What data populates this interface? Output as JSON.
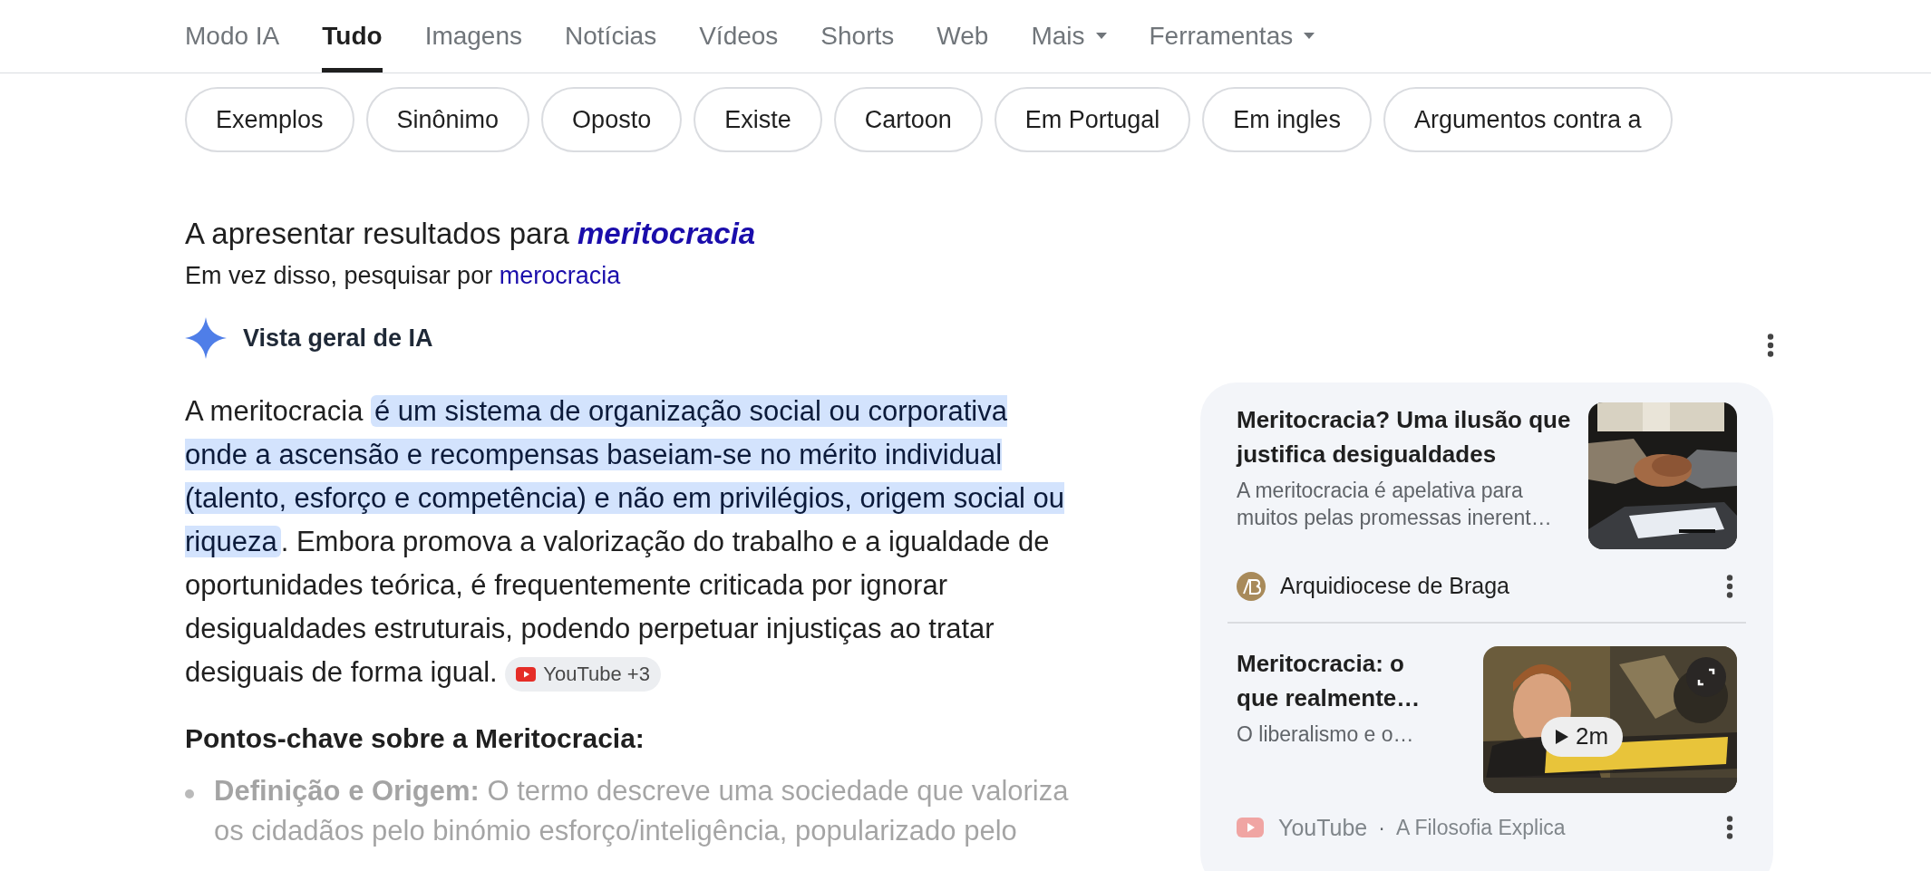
{
  "tabs": [
    {
      "label": "Modo IA",
      "selected": false,
      "dropdown": false
    },
    {
      "label": "Tudo",
      "selected": true,
      "dropdown": false
    },
    {
      "label": "Imagens",
      "selected": false,
      "dropdown": false
    },
    {
      "label": "Notícias",
      "selected": false,
      "dropdown": false
    },
    {
      "label": "Vídeos",
      "selected": false,
      "dropdown": false
    },
    {
      "label": "Shorts",
      "selected": false,
      "dropdown": false
    },
    {
      "label": "Web",
      "selected": false,
      "dropdown": false
    },
    {
      "label": "Mais",
      "selected": false,
      "dropdown": true
    },
    {
      "label": "Ferramentas",
      "selected": false,
      "dropdown": true
    }
  ],
  "chips": [
    "Exemplos",
    "Sinônimo",
    "Oposto",
    "Existe",
    "Cartoon",
    "Em Portugal",
    "Em ingles",
    "Argumentos contra a"
  ],
  "spelling": {
    "showing_prefix": "A apresentar resultados para",
    "corrected": "meritocracia",
    "instead_prefix": "Em vez disso, pesquisar por",
    "original": "merocracia"
  },
  "ai_overview": {
    "title": "Vista geral de IA",
    "paragraph": [
      {
        "text": "A meritocracia ",
        "highlighted": false
      },
      {
        "text": "é um sistema de organização social ou corporativa onde a ascensão e recompensas baseiam-se no mérito individual (talento, esforço e competência) e não em privilégios, origem social ou riqueza",
        "highlighted": true
      },
      {
        "text": ". Embora promova a valorização do trabalho e a igualdade de oportunidades teórica, é frequentemente criticada por ignorar desigualdades estruturais, podendo perpetuar injustiças ao tratar desiguais de forma igual. ",
        "highlighted": false
      }
    ],
    "citation": "YouTube +3",
    "subheading": "Pontos-chave sobre a Meritocracia:",
    "bullets": [
      {
        "term": "Definição e Origem:",
        "text": "O termo descreve uma sociedade que valoriza os cidadãos pelo binómio esforço/inteligência, popularizado pelo"
      }
    ]
  },
  "sources": [
    {
      "kind": "article",
      "title": "Meritocracia? Uma ilusão que justifica desigualdades",
      "snippet": "A meritocracia é apelativa para muitos pelas promessas inerent…",
      "site": "Arquidiocese de Braga"
    },
    {
      "kind": "video",
      "title": "Meritocracia: o que realmente…",
      "snippet": "O liberalismo e o…",
      "duration": "2m",
      "site": "YouTube",
      "separator": "·",
      "channel": "A Filosofia Explica"
    }
  ]
}
